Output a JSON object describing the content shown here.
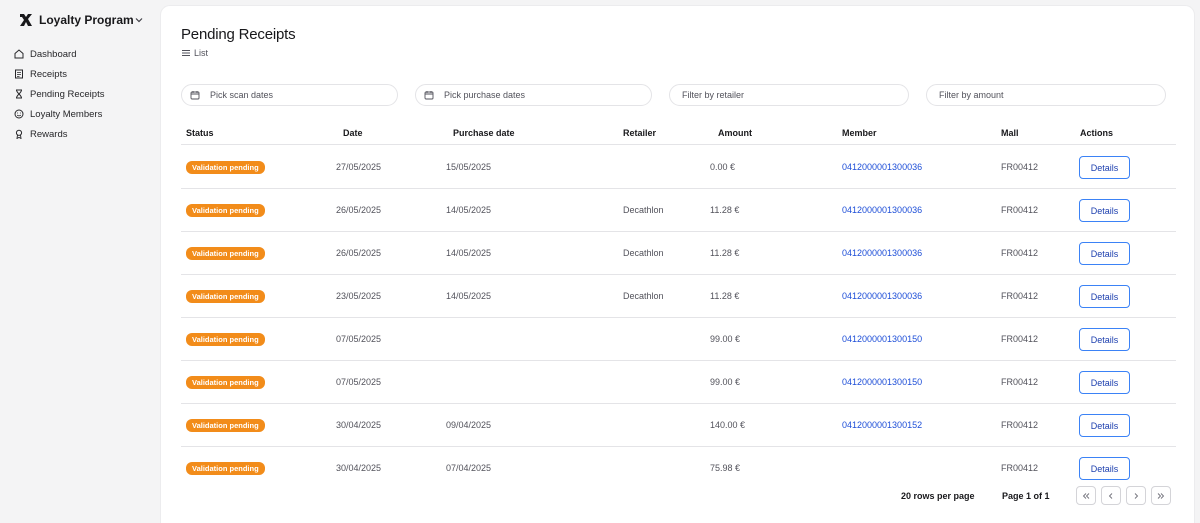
{
  "app": {
    "title": "Loyalty Program"
  },
  "sidebar": {
    "items": [
      {
        "label": "Dashboard",
        "icon": "home-icon"
      },
      {
        "label": "Receipts",
        "icon": "receipt-icon"
      },
      {
        "label": "Pending Receipts",
        "icon": "hourglass-icon"
      },
      {
        "label": "Loyalty Members",
        "icon": "smile-icon"
      },
      {
        "label": "Rewards",
        "icon": "award-icon"
      }
    ]
  },
  "page": {
    "title": "Pending Receipts",
    "view_label": "List"
  },
  "filters": {
    "scan_dates": "Pick scan dates",
    "purchase_dates": "Pick purchase dates",
    "retailer": "Filter by retailer",
    "amount": "Filter by amount"
  },
  "table": {
    "columns": [
      "Status",
      "Date",
      "Purchase date",
      "Retailer",
      "Amount",
      "Member",
      "Mall",
      "Actions"
    ],
    "details_label": "Details",
    "rows": [
      {
        "status": "Validation pending",
        "date": "27/05/2025",
        "purchase_date": "15/05/2025",
        "retailer": "",
        "amount": "0.00 €",
        "member": "0412000001300036",
        "mall": "FR00412"
      },
      {
        "status": "Validation pending",
        "date": "26/05/2025",
        "purchase_date": "14/05/2025",
        "retailer": "Decathlon",
        "amount": "11.28 €",
        "member": "0412000001300036",
        "mall": "FR00412"
      },
      {
        "status": "Validation pending",
        "date": "26/05/2025",
        "purchase_date": "14/05/2025",
        "retailer": "Decathlon",
        "amount": "11.28 €",
        "member": "0412000001300036",
        "mall": "FR00412"
      },
      {
        "status": "Validation pending",
        "date": "23/05/2025",
        "purchase_date": "14/05/2025",
        "retailer": "Decathlon",
        "amount": "11.28 €",
        "member": "0412000001300036",
        "mall": "FR00412"
      },
      {
        "status": "Validation pending",
        "date": "07/05/2025",
        "purchase_date": "",
        "retailer": "",
        "amount": "99.00 €",
        "member": "0412000001300150",
        "mall": "FR00412"
      },
      {
        "status": "Validation pending",
        "date": "07/05/2025",
        "purchase_date": "",
        "retailer": "",
        "amount": "99.00 €",
        "member": "0412000001300150",
        "mall": "FR00412"
      },
      {
        "status": "Validation pending",
        "date": "30/04/2025",
        "purchase_date": "09/04/2025",
        "retailer": "",
        "amount": "140.00 €",
        "member": "0412000001300152",
        "mall": "FR00412"
      },
      {
        "status": "Validation pending",
        "date": "30/04/2025",
        "purchase_date": "07/04/2025",
        "retailer": "",
        "amount": "75.98 €",
        "member": "",
        "mall": "FR00412"
      }
    ]
  },
  "pagination": {
    "rows_per_page": "20 rows per page",
    "page_info": "Page 1 of 1"
  },
  "colors": {
    "badge": "#f28c1a",
    "link": "#1d4ed8",
    "button_border": "#3b82f6"
  }
}
